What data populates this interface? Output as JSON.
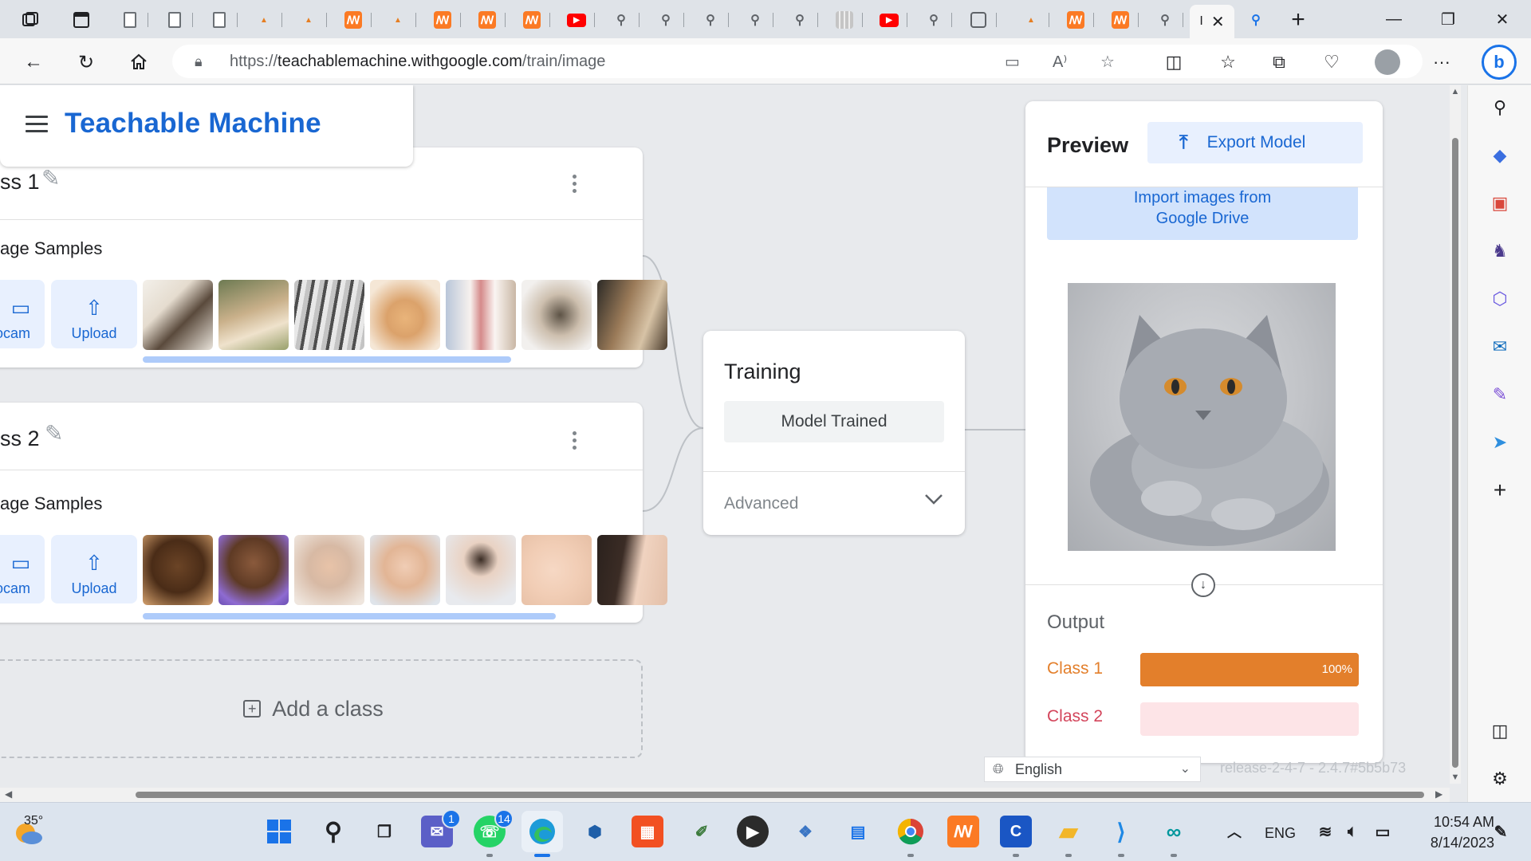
{
  "browser": {
    "url_prefix": "https://",
    "url_domain": "teachablemachine.withgoogle.com",
    "url_path": "/train/image",
    "active_tab_label": "I"
  },
  "app": {
    "title": "Teachable Machine"
  },
  "classes": [
    {
      "name": "ss 1",
      "samples_label": "age Samples",
      "webcam_label": "ocam",
      "upload_label": "Upload",
      "thumbs": [
        "cat-thumb-1",
        "cat-thumb-2",
        "cat-thumb-3",
        "cat-thumb-4",
        "cat-thumb-5",
        "cat-thumb-6",
        "cat-thumb-7"
      ]
    },
    {
      "name": "ss 2",
      "samples_label": "age Samples",
      "webcam_label": "ocam",
      "upload_label": "Upload",
      "thumbs": [
        "baby-thumb-1",
        "baby-thumb-2",
        "baby-thumb-3",
        "baby-thumb-4",
        "baby-thumb-5",
        "baby-thumb-6",
        "baby-thumb-7"
      ]
    }
  ],
  "add_class_label": "Add a class",
  "training": {
    "title": "Training",
    "status_button": "Model Trained",
    "advanced_label": "Advanced"
  },
  "preview": {
    "title": "Preview",
    "export_label": "Export Model",
    "import_line1": "Import images from",
    "import_line2": "Google Drive",
    "output_title": "Output",
    "outputs": [
      {
        "label": "Class 1",
        "percent_text": "100%",
        "confidence": 1.0,
        "color": "#e37f2b",
        "track": "#e37f2b"
      },
      {
        "label": "Class 2",
        "percent_text": "",
        "confidence": 0.0,
        "color": "#d3455b",
        "track": "#fde4e7"
      }
    ]
  },
  "footer": {
    "language": "English",
    "release": "release-2-4-7 - 2.4.7#5b5b73"
  },
  "taskbar": {
    "weather_temp": "35°",
    "teams_badge": "1",
    "whatsapp_badge": "14",
    "language": "ENG",
    "time": "10:54 AM",
    "date": "8/14/2023"
  },
  "colors": {
    "brand_blue": "#1967d2",
    "class1_orange": "#e37f2b",
    "class2_pink": "#d3455b"
  }
}
